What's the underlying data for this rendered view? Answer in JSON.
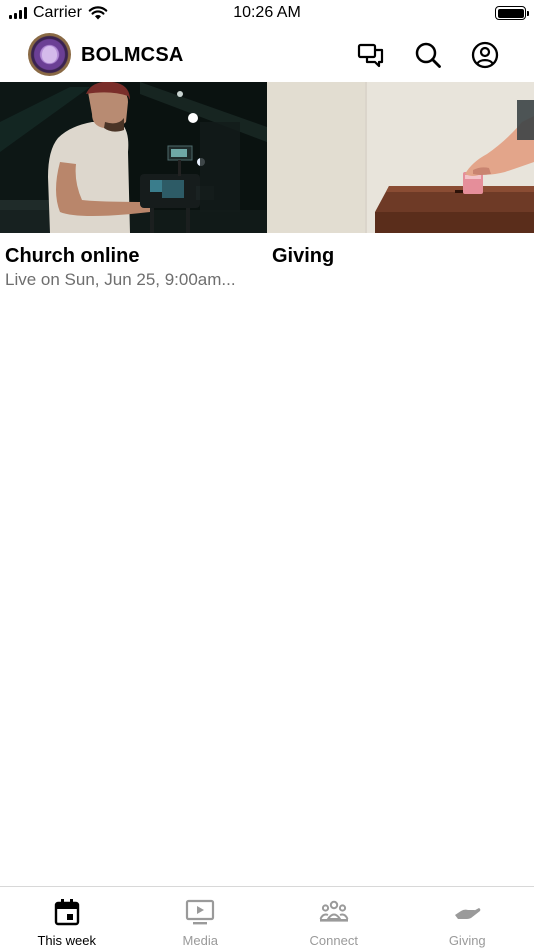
{
  "status_bar": {
    "carrier": "Carrier",
    "time": "10:26 AM",
    "icons": [
      "signal-icon",
      "wifi-icon",
      "battery-icon"
    ]
  },
  "header": {
    "brand_name": "BOLMCSA",
    "icons": [
      "avatar",
      "chat-icon",
      "search-icon",
      "profile-icon"
    ]
  },
  "cards": [
    {
      "title": "Church online",
      "subtitle": "Live on Sun, Jun 25, 9:00am..."
    },
    {
      "title": "Giving",
      "subtitle": ""
    }
  ],
  "tabs": [
    {
      "label": "This week",
      "icon": "calendar-icon",
      "active": true
    },
    {
      "label": "Media",
      "icon": "tv-play-icon",
      "active": false
    },
    {
      "label": "Connect",
      "icon": "people-group-icon",
      "active": false
    },
    {
      "label": "Giving",
      "icon": "hand-icon",
      "active": false
    }
  ],
  "colors": {
    "active": "#000000",
    "inactive": "#9a9a9a",
    "subtitle": "#6e6e6e",
    "divider": "#d8d8d8"
  }
}
